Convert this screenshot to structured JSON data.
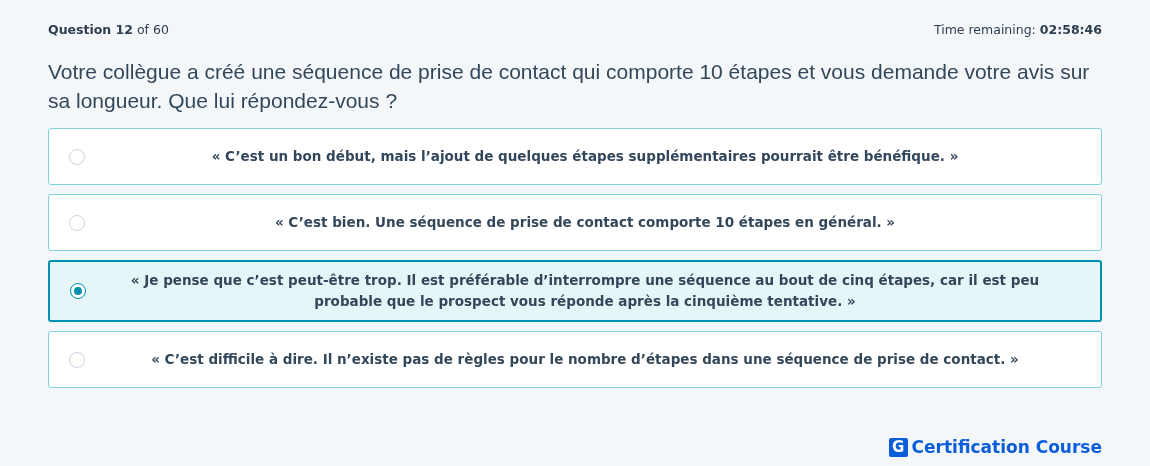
{
  "header": {
    "question_label": "**Question 12** of 60",
    "timer_label": "Time remaining:",
    "timer_value": "02:58:46"
  },
  "question": "Votre collègue a créé une séquence de prise de contact qui comporte 10 étapes et vous demande votre avis sur sa longueur. Que lui répondez-vous ?",
  "options": [
    {
      "text": "« C’est un bon début, mais l’ajout de quelques étapes supplémentaires pourrait être bénéfique. »",
      "selected": false
    },
    {
      "text": "« C’est bien. Une séquence de prise de contact comporte 10 étapes en général. »",
      "selected": false
    },
    {
      "text": "« Je pense que c’est peut-être trop. Il est préférable d’interrompre une séquence au bout de cinq étapes, car il est peu probable que le prospect vous réponde après la cinquième tentative. »",
      "selected": true
    },
    {
      "text": "« C’est difficile à dire. Il n’existe pas de règles pour le nombre d’étapes dans une séquence de prise de contact. »",
      "selected": false
    }
  ],
  "footer": {
    "logo_mark": "G",
    "logo_text": "Certification Course"
  }
}
